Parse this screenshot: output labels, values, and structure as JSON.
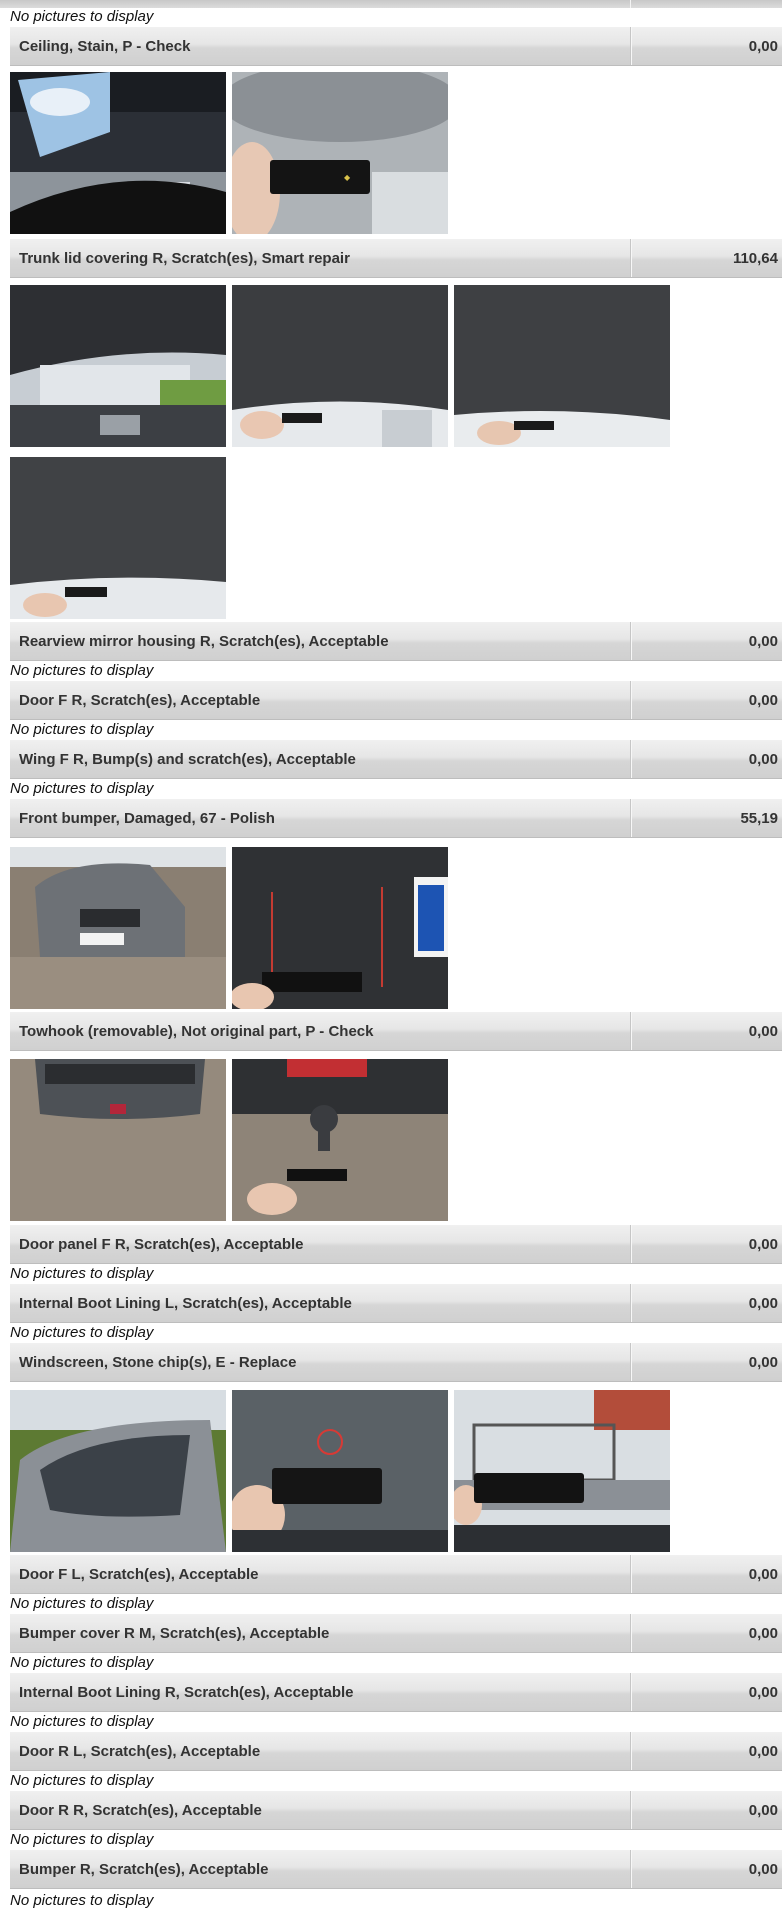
{
  "top_caption": "No pictures to display",
  "no_pictures_text": "No pictures to display",
  "items": [
    {
      "description": "Ceiling, Stain, P - Check",
      "amount": "0,00",
      "photos": [
        "car-interior-sunroof-photo",
        "ceiling-measure-card-photo"
      ]
    },
    {
      "description": "Trunk lid covering R, Scratch(es), Smart repair",
      "amount": "110,64",
      "photos": [
        "open-trunk-lid-photo",
        "trunk-lid-measure-photo",
        "trunk-lid-closeup-photo",
        "trunk-lid-corner-photo"
      ]
    },
    {
      "description": "Rearview mirror housing R, Scratch(es), Acceptable",
      "amount": "0,00",
      "photos": []
    },
    {
      "description": "Door F R, Scratch(es), Acceptable",
      "amount": "0,00",
      "photos": []
    },
    {
      "description": "Wing F R, Bump(s) and scratch(es), Acceptable",
      "amount": "0,00",
      "photos": []
    },
    {
      "description": "Front bumper, Damaged, 67 - Polish",
      "amount": "55,19",
      "photos": [
        "car-front-view-photo",
        "front-bumper-marked-damage-photo"
      ]
    },
    {
      "description": "Towhook (removable), Not original part, P - Check",
      "amount": "0,00",
      "photos": [
        "car-rear-view-photo",
        "towhook-closeup-photo"
      ]
    },
    {
      "description": "Door panel F R, Scratch(es), Acceptable",
      "amount": "0,00",
      "photos": []
    },
    {
      "description": "Internal Boot Lining L, Scratch(es), Acceptable",
      "amount": "0,00",
      "photos": []
    },
    {
      "description": "Windscreen, Stone chip(s), E - Replace",
      "amount": "0,00",
      "photos": [
        "car-windscreen-exterior-photo",
        "windscreen-chip-marked-photo",
        "windscreen-interior-view-photo"
      ]
    },
    {
      "description": "Door F L, Scratch(es), Acceptable",
      "amount": "0,00",
      "photos": []
    },
    {
      "description": "Bumper cover R M, Scratch(es), Acceptable",
      "amount": "0,00",
      "photos": []
    },
    {
      "description": "Internal Boot Lining R, Scratch(es), Acceptable",
      "amount": "0,00",
      "photos": []
    },
    {
      "description": "Door R L, Scratch(es), Acceptable",
      "amount": "0,00",
      "photos": []
    },
    {
      "description": "Door R R, Scratch(es), Acceptable",
      "amount": "0,00",
      "photos": []
    },
    {
      "description": "Bumper R, Scratch(es), Acceptable",
      "amount": "0,00",
      "photos": []
    }
  ],
  "colors": {
    "row_gradient_top": "#f0f0f0",
    "row_gradient_bottom": "#d0d0d0",
    "text": "#333333"
  }
}
